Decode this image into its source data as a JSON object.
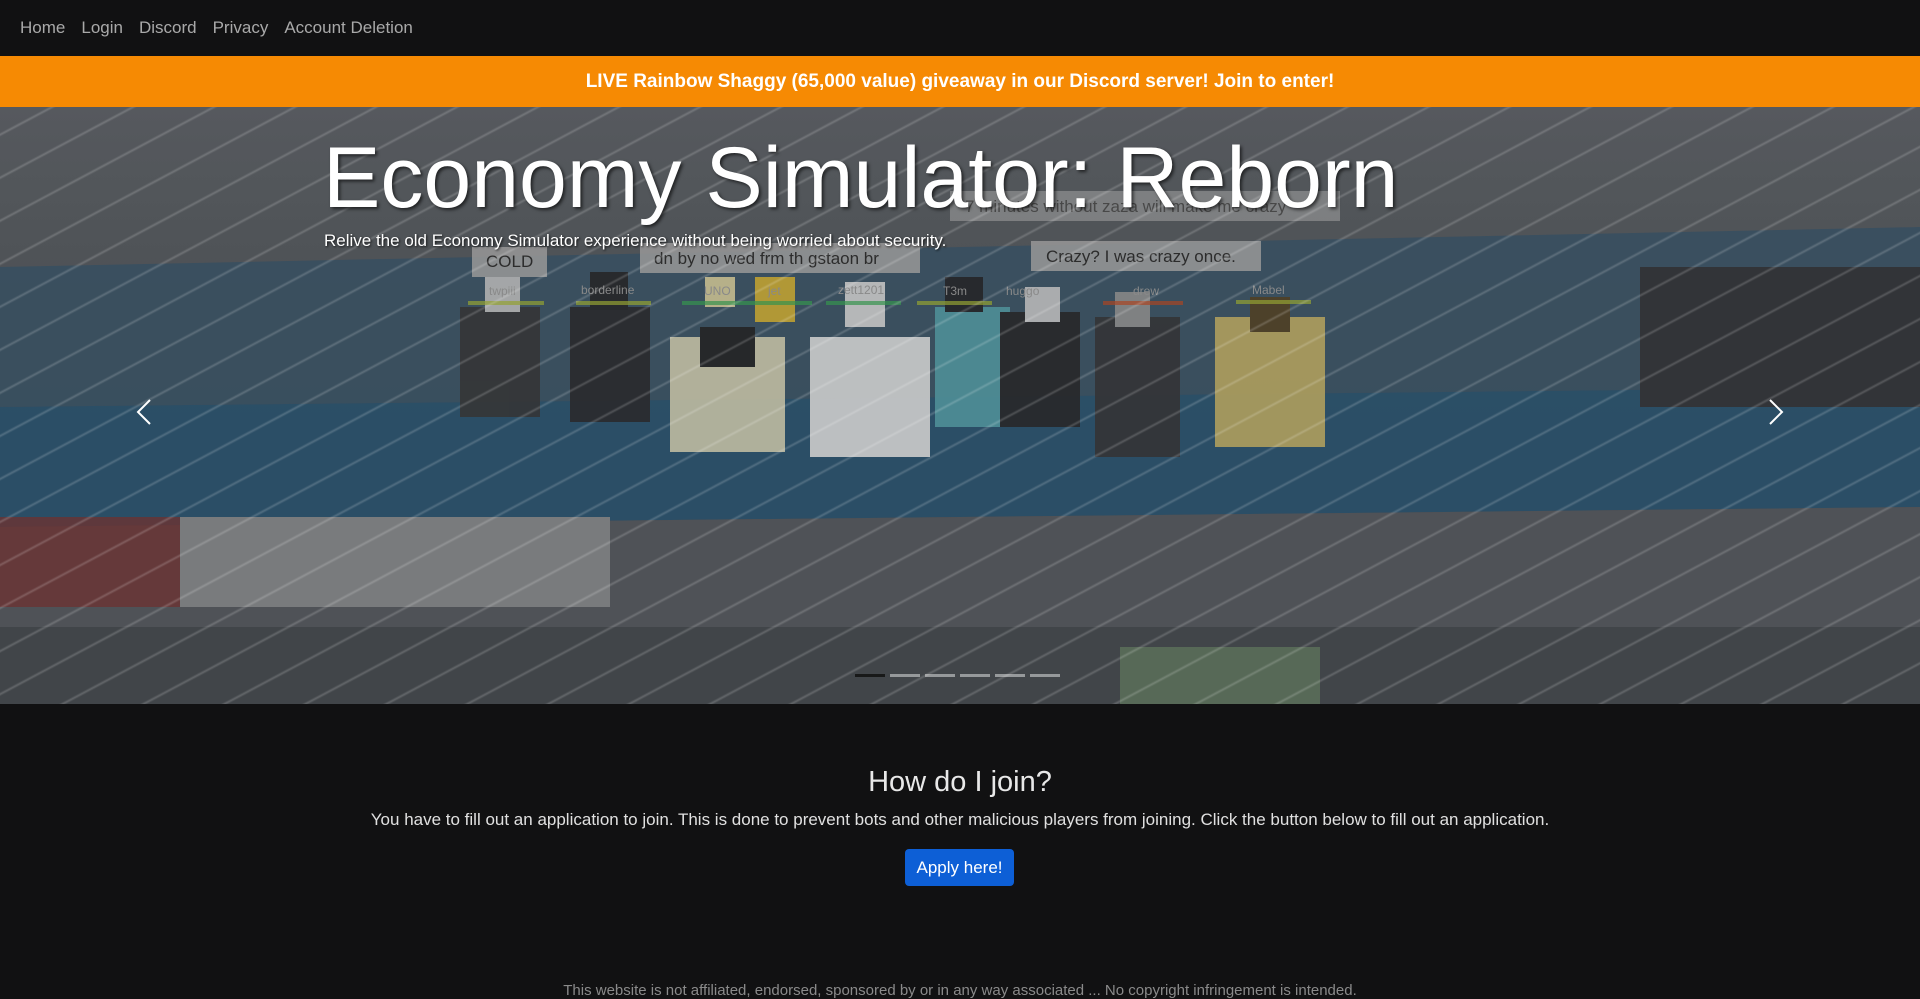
{
  "nav": {
    "items": [
      {
        "label": "Home"
      },
      {
        "label": "Login"
      },
      {
        "label": "Discord"
      },
      {
        "label": "Privacy"
      },
      {
        "label": "Account Deletion"
      }
    ]
  },
  "banner": {
    "text": "LIVE Rainbow Shaggy (65,000 value) giveaway in our Discord server! Join to enter!",
    "color": "#f68a03"
  },
  "hero": {
    "title": "Economy Simulator: Reborn",
    "subtitle": "Relive the old Economy Simulator experience without being worried about security.",
    "prev_icon": "chevron-left-icon",
    "next_icon": "chevron-right-icon",
    "slide_count": 6,
    "active_slide": 0,
    "scene": {
      "chat_bubbles": [
        "COLD",
        "dn by no wed frm th gstaon br",
        "7 minutes without zaza will make me crazy",
        "Crazy? I was crazy once."
      ],
      "player_names": [
        "twpiii",
        "borderline",
        "UNO",
        "jet",
        "zett1201",
        "T3m",
        "huggo",
        "drew",
        "Mabel"
      ]
    }
  },
  "join": {
    "heading": "How do I join?",
    "text": "You have to fill out an application to join. This is done to prevent bots and other malicious players from joining. Click the button below to fill out an application.",
    "button_label": "Apply here!",
    "button_color": "#0d5fd6"
  },
  "footer": {
    "text": "This website is not affiliated, endorsed, sponsored by or in any way associated ... No copyright infringement is intended."
  }
}
